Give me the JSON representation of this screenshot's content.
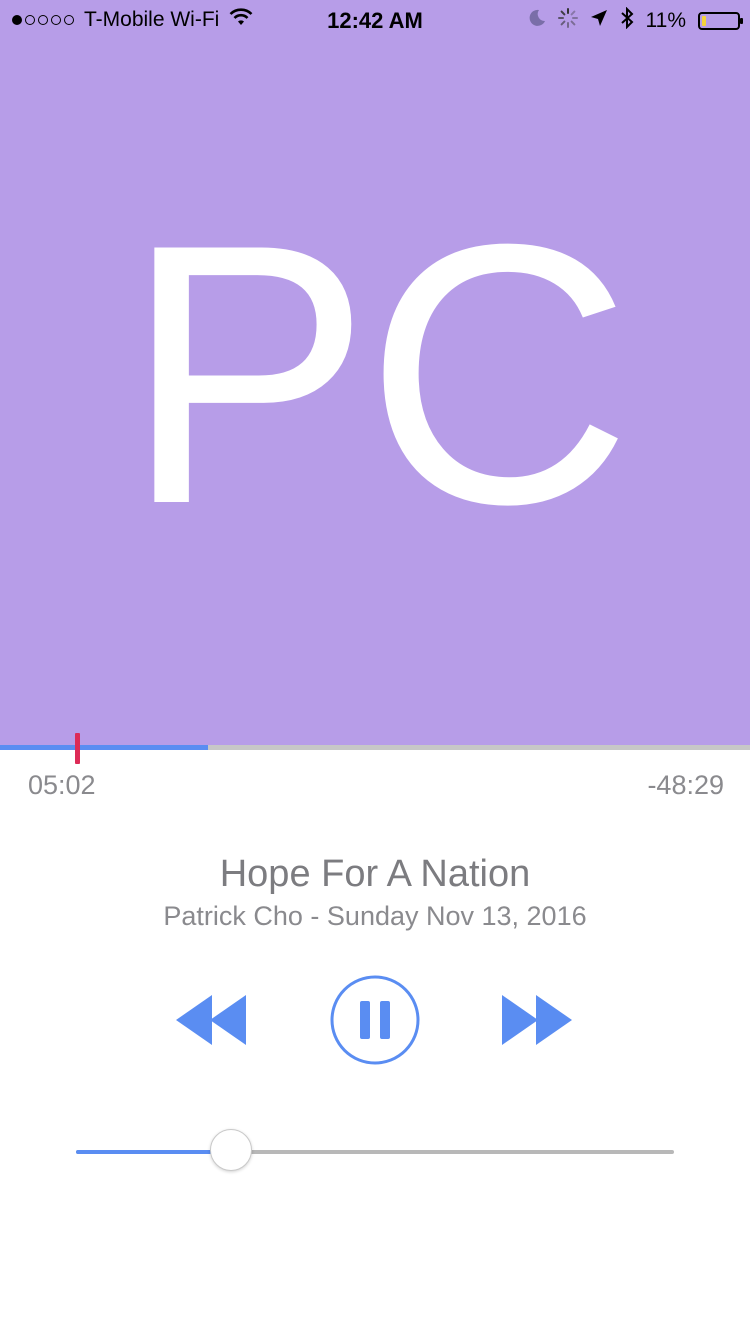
{
  "status_bar": {
    "carrier": "T-Mobile Wi-Fi",
    "time": "12:42 AM",
    "battery": "11%",
    "signal_bars_filled": 1,
    "signal_bars_total": 5
  },
  "artwork": {
    "initials": "PC",
    "background_color": "#b79de8"
  },
  "progress": {
    "elapsed": "05:02",
    "remaining": "-48:29",
    "buffered_fraction": 0.277,
    "played_fraction": 0.1,
    "played_color": "#5a8df2",
    "marker_color": "#dd2b57"
  },
  "episode": {
    "title": "Hope For A Nation",
    "subtitle": "Patrick Cho - Sunday Nov 13, 2016"
  },
  "controls": {
    "rewind_icon": "rewind-icon",
    "play_state_icon": "pause-icon",
    "forward_icon": "fast-forward-icon",
    "accent_color": "#5a8df2"
  },
  "volume": {
    "level_fraction": 0.26
  }
}
